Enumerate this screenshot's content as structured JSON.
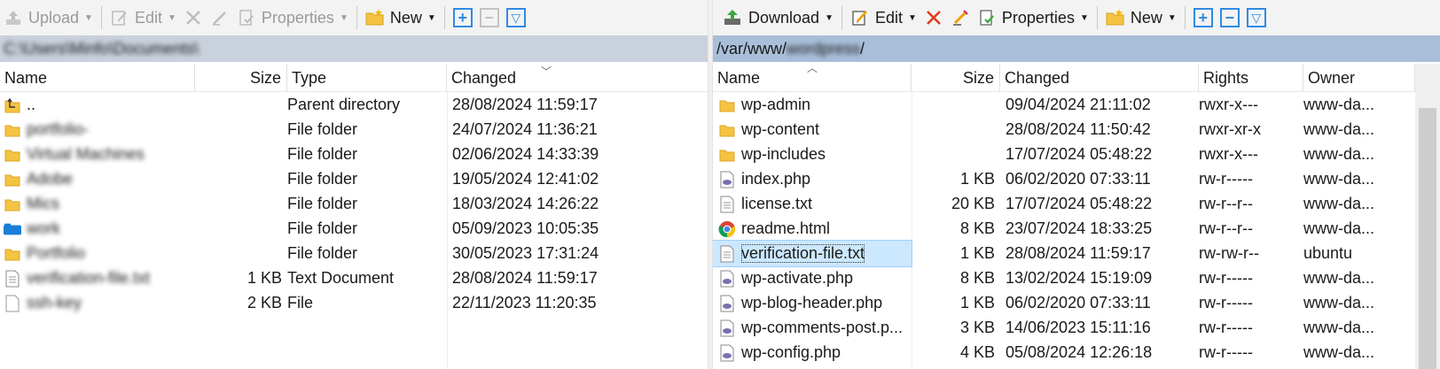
{
  "left": {
    "toolbar": {
      "upload": "Upload",
      "edit": "Edit",
      "properties": "Properties",
      "new": "New"
    },
    "path": "C:\\Users\\Minfo\\Documents\\",
    "columns": {
      "name": "Name",
      "size": "Size",
      "type": "Type",
      "changed": "Changed"
    },
    "rows": [
      {
        "name": "..",
        "size": "",
        "type": "Parent directory",
        "changed": "28/08/2024 11:59:17",
        "icon": "parent-folder-icon"
      },
      {
        "name": "portfolio-",
        "size": "",
        "type": "File folder",
        "changed": "24/07/2024 11:36:21",
        "icon": "folder-icon"
      },
      {
        "name": "Virtual Machines",
        "size": "",
        "type": "File folder",
        "changed": "02/06/2024 14:33:39",
        "icon": "folder-icon"
      },
      {
        "name": "Adobe",
        "size": "",
        "type": "File folder",
        "changed": "19/05/2024 12:41:02",
        "icon": "folder-icon"
      },
      {
        "name": "Mics",
        "size": "",
        "type": "File folder",
        "changed": "18/03/2024 14:26:22",
        "icon": "folder-icon"
      },
      {
        "name": "work",
        "size": "",
        "type": "File folder",
        "changed": "05/09/2023 10:05:35",
        "icon": "blue-folder-icon"
      },
      {
        "name": "Portfolio",
        "size": "",
        "type": "File folder",
        "changed": "30/05/2023 17:31:24",
        "icon": "folder-icon"
      },
      {
        "name": "verification-file.txt",
        "size": "1 KB",
        "type": "Text Document",
        "changed": "28/08/2024 11:59:17",
        "icon": "text-file-icon"
      },
      {
        "name": "ssh-key",
        "size": "2 KB",
        "type": "File",
        "changed": "22/11/2023 11:20:35",
        "icon": "file-icon"
      }
    ]
  },
  "right": {
    "toolbar": {
      "download": "Download",
      "edit": "Edit",
      "properties": "Properties",
      "new": "New"
    },
    "path_prefix": "/var/www/",
    "path_blurred": "wordpress",
    "path_suffix": "/",
    "columns": {
      "name": "Name",
      "size": "Size",
      "changed": "Changed",
      "rights": "Rights",
      "owner": "Owner"
    },
    "rows": [
      {
        "name": "wp-admin",
        "size": "",
        "changed": "09/04/2024 21:11:02",
        "rights": "rwxr-x---",
        "owner": "www-da...",
        "icon": "folder-icon"
      },
      {
        "name": "wp-content",
        "size": "",
        "changed": "28/08/2024 11:50:42",
        "rights": "rwxr-xr-x",
        "owner": "www-da...",
        "icon": "folder-icon"
      },
      {
        "name": "wp-includes",
        "size": "",
        "changed": "17/07/2024 05:48:22",
        "rights": "rwxr-x---",
        "owner": "www-da...",
        "icon": "folder-icon"
      },
      {
        "name": "index.php",
        "size": "1 KB",
        "changed": "06/02/2020 07:33:11",
        "rights": "rw-r-----",
        "owner": "www-da...",
        "icon": "php-file-icon"
      },
      {
        "name": "license.txt",
        "size": "20 KB",
        "changed": "17/07/2024 05:48:22",
        "rights": "rw-r--r--",
        "owner": "www-da...",
        "icon": "text-file-icon"
      },
      {
        "name": "readme.html",
        "size": "8 KB",
        "changed": "23/07/2024 18:33:25",
        "rights": "rw-r--r--",
        "owner": "www-da...",
        "icon": "chrome-icon"
      },
      {
        "name": "verification-file.txt",
        "size": "1 KB",
        "changed": "28/08/2024 11:59:17",
        "rights": "rw-rw-r--",
        "owner": "ubuntu",
        "icon": "text-file-icon"
      },
      {
        "name": "wp-activate.php",
        "size": "8 KB",
        "changed": "13/02/2024 15:19:09",
        "rights": "rw-r-----",
        "owner": "www-da...",
        "icon": "php-file-icon"
      },
      {
        "name": "wp-blog-header.php",
        "size": "1 KB",
        "changed": "06/02/2020 07:33:11",
        "rights": "rw-r-----",
        "owner": "www-da...",
        "icon": "php-file-icon"
      },
      {
        "name": "wp-comments-post.p...",
        "size": "3 KB",
        "changed": "14/06/2023 15:11:16",
        "rights": "rw-r-----",
        "owner": "www-da...",
        "icon": "php-file-icon"
      },
      {
        "name": "wp-config.php",
        "size": "4 KB",
        "changed": "05/08/2024 12:26:18",
        "rights": "rw-r-----",
        "owner": "www-da...",
        "icon": "php-file-icon"
      }
    ]
  },
  "colors": {
    "accent": "#2f8be6",
    "selection": "#cce8ff",
    "folder": "#f5c342",
    "path_bar_right": "#a9bfd9"
  }
}
